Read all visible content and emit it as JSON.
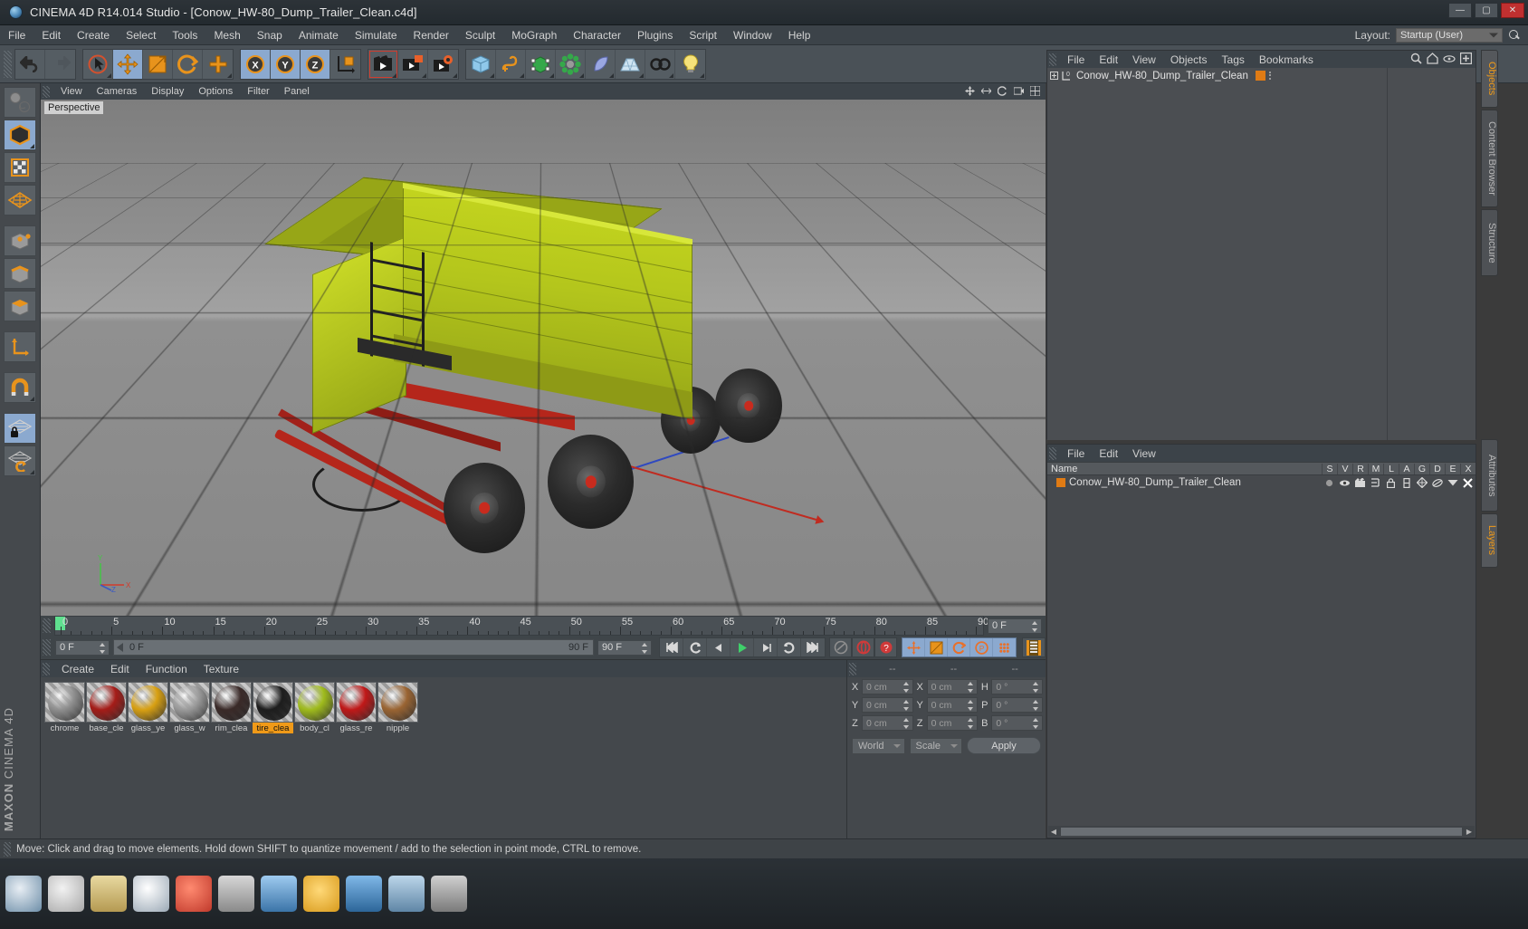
{
  "window": {
    "title": "CINEMA 4D R14.014 Studio - [Conow_HW-80_Dump_Trailer_Clean.c4d]",
    "minimize": "—",
    "maximize": "▢",
    "close": "✕"
  },
  "menubar": {
    "items": [
      "File",
      "Edit",
      "Create",
      "Select",
      "Tools",
      "Mesh",
      "Snap",
      "Animate",
      "Simulate",
      "Render",
      "Sculpt",
      "MoGraph",
      "Character",
      "Plugins",
      "Script",
      "Window",
      "Help"
    ],
    "layout_label": "Layout:",
    "layout_value": "Startup (User)"
  },
  "toolbar": {
    "groups": [
      {
        "name": "undo-redo",
        "buttons": [
          {
            "name": "undo-button",
            "icon": "undo-icon"
          },
          {
            "name": "redo-button",
            "icon": "redo-icon"
          }
        ]
      },
      {
        "name": "transform-tools",
        "buttons": [
          {
            "name": "live-selection-button",
            "icon": "live-selection-icon"
          },
          {
            "name": "move-button",
            "icon": "move-icon"
          },
          {
            "name": "scale-button",
            "icon": "scale-icon"
          },
          {
            "name": "rotate-button",
            "icon": "rotate-icon"
          },
          {
            "name": "add-tool-button",
            "icon": "plus-icon"
          }
        ]
      },
      {
        "name": "axis-locks",
        "buttons": [
          {
            "name": "lock-x-button",
            "icon": "x-axis-icon"
          },
          {
            "name": "lock-y-button",
            "icon": "y-axis-icon"
          },
          {
            "name": "lock-z-button",
            "icon": "z-axis-icon"
          },
          {
            "name": "world-object-coord-button",
            "icon": "world-axis-icon"
          }
        ]
      },
      {
        "name": "render-tools",
        "buttons": [
          {
            "name": "render-view-button",
            "icon": "render-view-icon"
          },
          {
            "name": "render-region-button",
            "icon": "render-region-icon"
          },
          {
            "name": "render-settings-button",
            "icon": "render-settings-icon"
          }
        ]
      },
      {
        "name": "object-creation",
        "buttons": [
          {
            "name": "add-cube-button",
            "icon": "cube-icon"
          },
          {
            "name": "add-spline-button",
            "icon": "spline-icon"
          },
          {
            "name": "nurbs-button",
            "icon": "nurbs-icon"
          },
          {
            "name": "array-button",
            "icon": "array-icon"
          },
          {
            "name": "deformer-button",
            "icon": "bend-deformer-icon"
          },
          {
            "name": "environment-button",
            "icon": "floor-icon"
          },
          {
            "name": "camera-button",
            "icon": "camera-icon"
          },
          {
            "name": "light-button",
            "icon": "light-bulb-icon"
          }
        ]
      }
    ]
  },
  "left_toolbar": {
    "buttons": [
      {
        "name": "tool-make-editable",
        "icon": "make-editable-icon",
        "active": false
      },
      {
        "name": "tool-model-mode",
        "icon": "model-mode-icon",
        "active": true
      },
      {
        "name": "tool-texture-mode",
        "icon": "texture-mode-icon",
        "active": false
      },
      {
        "name": "tool-points-mode",
        "icon": "points-mode-icon",
        "active": false
      },
      {
        "name": "tool-point-mode",
        "icon": "point-mode-icon",
        "active": false
      },
      {
        "name": "tool-edge-mode",
        "icon": "edge-mode-icon",
        "active": false
      },
      {
        "name": "tool-polygon-mode",
        "icon": "polygon-mode-icon",
        "active": false
      },
      {
        "name": "tool-axis-mode",
        "icon": "axis-mode-icon",
        "active": false
      },
      {
        "name": "tool-snap",
        "icon": "magnet-icon",
        "active": false
      },
      {
        "name": "tool-workplane-lock",
        "icon": "workplane-lock-icon",
        "active": true
      },
      {
        "name": "tool-workplane-rotate",
        "icon": "workplane-rotate-icon",
        "active": false
      }
    ],
    "brand_line1": "MAXON",
    "brand_line2": "CINEMA 4D"
  },
  "viewport": {
    "menu": [
      "View",
      "Cameras",
      "Display",
      "Options",
      "Filter",
      "Panel"
    ],
    "label": "Perspective",
    "gizmo_axes": [
      "Y",
      "X",
      "Z"
    ],
    "corner_icons": [
      "move-view-icon",
      "scale-view-icon",
      "rotate-view-icon",
      "camera-view-icon",
      "layout-view-icon"
    ],
    "scene_object": "Conow HW-80 Dump Trailer"
  },
  "timeline": {
    "ruler_labels": [
      "0",
      "5",
      "10",
      "15",
      "20",
      "25",
      "30",
      "35",
      "40",
      "45",
      "50",
      "55",
      "60",
      "65",
      "70",
      "75",
      "80",
      "85",
      "90"
    ],
    "current_frame_right": "0 F",
    "start_field": "0 F",
    "range_start": "0 F",
    "range_end": "90 F",
    "end_field": "90 F",
    "transport": [
      {
        "name": "go-to-start-button",
        "icon": "skip-start-icon"
      },
      {
        "name": "go-to-previous-key-button",
        "icon": "prev-key-icon"
      },
      {
        "name": "step-back-button",
        "icon": "step-back-icon"
      },
      {
        "name": "play-button",
        "icon": "play-icon"
      },
      {
        "name": "step-forward-button",
        "icon": "step-forward-icon"
      },
      {
        "name": "go-to-next-key-button",
        "icon": "next-key-icon"
      },
      {
        "name": "go-to-end-button",
        "icon": "skip-end-icon"
      }
    ],
    "record_group": [
      {
        "name": "autokeying-button",
        "icon": "autokey-icon"
      },
      {
        "name": "record-active-objects-button",
        "icon": "record-icon"
      },
      {
        "name": "keyframe-selection-button",
        "icon": "question-icon"
      }
    ],
    "key_group": [
      {
        "name": "position-key-button",
        "icon": "position-key-icon"
      },
      {
        "name": "scale-key-button",
        "icon": "scale-key-icon"
      },
      {
        "name": "rotation-key-button",
        "icon": "rotation-key-icon"
      },
      {
        "name": "parameter-key-button",
        "icon": "parameter-key-icon"
      },
      {
        "name": "point-level-animation-button",
        "icon": "pla-icon"
      }
    ],
    "film_button": {
      "name": "timeline-film-button",
      "icon": "film-strip-icon"
    }
  },
  "material_manager": {
    "menu": [
      "Create",
      "Edit",
      "Function",
      "Texture"
    ],
    "materials": [
      {
        "name": "chrome",
        "color": "#8e8e8e",
        "selected": false
      },
      {
        "name": "base_cle",
        "color": "#a51c18",
        "selected": false
      },
      {
        "name": "glass_ye",
        "color": "#d8a012",
        "selected": false
      },
      {
        "name": "glass_w",
        "color": "#9a9a9a",
        "selected": false
      },
      {
        "name": "rim_clea",
        "color": "#3a2a28",
        "selected": false
      },
      {
        "name": "tire_clea",
        "color": "#1d1d1d",
        "selected": true
      },
      {
        "name": "body_cl",
        "color": "#9fbb1c",
        "selected": false
      },
      {
        "name": "glass_re",
        "color": "#c01818",
        "selected": false
      },
      {
        "name": "nipple",
        "color": "#9a6432",
        "selected": false
      }
    ]
  },
  "coordinate_manager": {
    "header": [
      "--",
      "--",
      "--"
    ],
    "rows": [
      {
        "pos_label": "X",
        "pos_value": "0 cm",
        "size_label": "X",
        "size_value": "0 cm",
        "rot_label": "H",
        "rot_value": "0 °"
      },
      {
        "pos_label": "Y",
        "pos_value": "0 cm",
        "size_label": "Y",
        "size_value": "0 cm",
        "rot_label": "P",
        "rot_value": "0 °"
      },
      {
        "pos_label": "Z",
        "pos_value": "0 cm",
        "size_label": "Z",
        "size_value": "0 cm",
        "rot_label": "B",
        "rot_value": "0 °"
      }
    ],
    "coord_system": "World",
    "mode": "Scale",
    "apply_label": "Apply"
  },
  "object_manager": {
    "menu": [
      "File",
      "Edit",
      "View",
      "Objects",
      "Tags",
      "Bookmarks"
    ],
    "icons": [
      "search-icon",
      "home-icon",
      "eye-icon",
      "add-layer-icon"
    ],
    "items": [
      {
        "label": "Conow_HW-80_Dump_Trailer_Clean",
        "level": 0,
        "has_children": true,
        "tag_color": "#e07b14"
      }
    ]
  },
  "layer_manager": {
    "menu": [
      "File",
      "Edit",
      "View"
    ],
    "columns": [
      "S",
      "V",
      "R",
      "M",
      "L",
      "A",
      "G",
      "D",
      "E",
      "X"
    ],
    "name_header": "Name",
    "rows": [
      {
        "label": "Conow_HW-80_Dump_Trailer_Clean",
        "swatch": "#e07b14"
      }
    ]
  },
  "right_tabs": [
    {
      "label": "Objects",
      "active": true
    },
    {
      "label": "Content Browser",
      "active": false
    },
    {
      "label": "Structure",
      "active": false
    },
    {
      "label": "Attributes",
      "active": false
    },
    {
      "label": "Layers",
      "active": true
    }
  ],
  "statusbar": {
    "text": "Move: Click and drag to move elements. Hold down SHIFT to quantize movement / add to the selection in point mode, CTRL to remove."
  },
  "taskbar": {
    "icons": [
      "browser-icon",
      "folder-icon",
      "document-icon",
      "browser2-icon",
      "media-icon",
      "files-icon",
      "window-icon",
      "star-icon",
      "blue-app-icon",
      "app-icon",
      "calc-icon"
    ]
  },
  "colors": {
    "accent_orange": "#f09a18",
    "active_blue": "#8ba9cf",
    "panel_bg": "#46494d",
    "toolbar_bg": "#4a5157",
    "body_green": "#b4c61c",
    "chassis_red": "#b5261b"
  }
}
